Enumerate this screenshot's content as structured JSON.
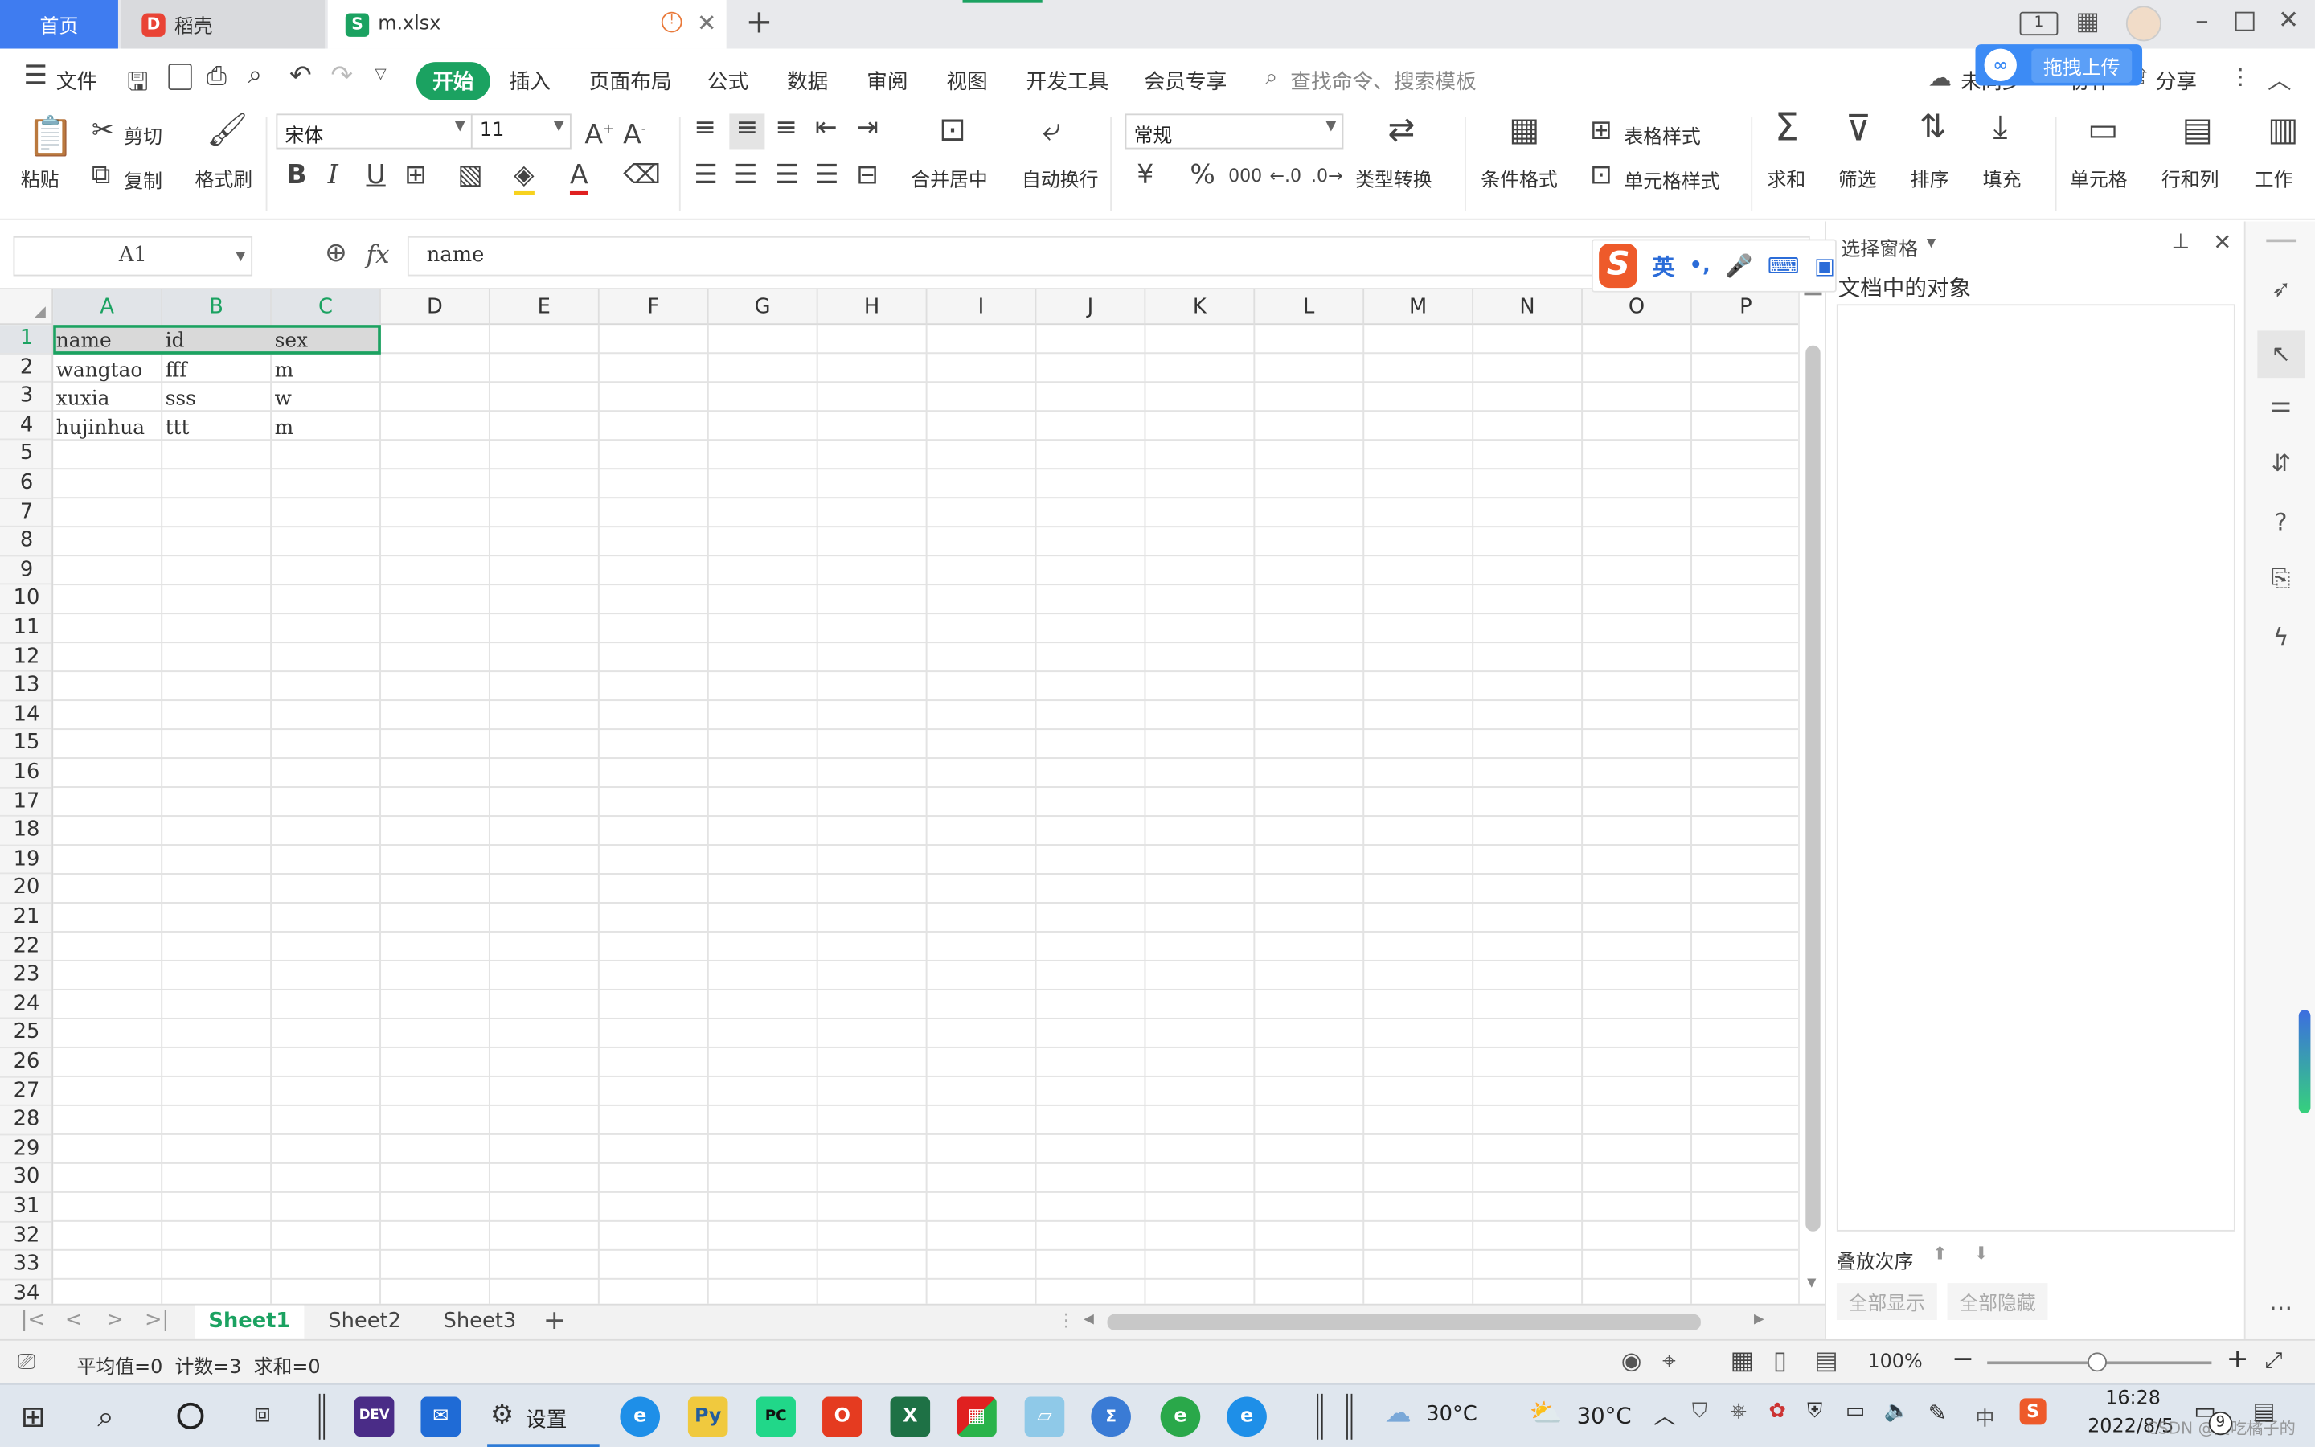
{
  "tabs": {
    "home": "首页",
    "daoke": "稻壳",
    "file": "m.xlsx",
    "new_tab": "+"
  },
  "menu": {
    "file": "文件",
    "items": [
      "开始",
      "插入",
      "页面布局",
      "公式",
      "数据",
      "审阅",
      "视图",
      "开发工具",
      "会员专享"
    ],
    "search_placeholder": "查找命令、搜索模板",
    "sync": "未同步",
    "collab": "协作",
    "share": "分享",
    "upload": "拖拽上传"
  },
  "ribbon": {
    "paste": "粘贴",
    "cut": "剪切",
    "copy": "复制",
    "format_painter": "格式刷",
    "font_name": "宋体",
    "font_size": "11",
    "merge_center": "合并居中",
    "wrap_text": "自动换行",
    "number_format": "常规",
    "currency": "¥",
    "percent": "%",
    "thousands": "000",
    "type_convert": "类型转换",
    "cond_format": "条件格式",
    "table_style": "表格样式",
    "cell_style": "单元格样式",
    "sum": "求和",
    "filter": "筛选",
    "sort": "排序",
    "fill": "填充",
    "cell": "单元格",
    "row_col": "行和列",
    "worksheet": "工作"
  },
  "formula_bar": {
    "name_box": "A1",
    "fx": "fx",
    "content": "name"
  },
  "grid": {
    "columns": [
      "A",
      "B",
      "C",
      "D",
      "E",
      "F",
      "G",
      "H",
      "I",
      "J",
      "K",
      "L",
      "M",
      "N",
      "O",
      "P"
    ],
    "rows": [
      "1",
      "2",
      "3",
      "4",
      "5",
      "6",
      "7",
      "8",
      "9",
      "10",
      "11",
      "12",
      "13",
      "14",
      "15",
      "16",
      "17",
      "18",
      "19",
      "20",
      "21",
      "22",
      "23",
      "24",
      "25",
      "26",
      "27",
      "28",
      "29",
      "30",
      "31",
      "32",
      "33",
      "34"
    ],
    "data": [
      [
        "name",
        "id",
        "sex"
      ],
      [
        "wangtao",
        "fff",
        "m"
      ],
      [
        "xuxia",
        "sss",
        "w"
      ],
      [
        "hujinhua",
        "ttt",
        "m"
      ]
    ]
  },
  "sheets": [
    "Sheet1",
    "Sheet2",
    "Sheet3"
  ],
  "status": {
    "stats": "平均值=0  计数=3  求和=0",
    "zoom": "100%"
  },
  "pane": {
    "title": "选择窗格",
    "heading": "文档中的对象",
    "order_label": "叠放次序",
    "show_all": "全部显示",
    "hide_all": "全部隐藏"
  },
  "ime": {
    "lang": "英"
  },
  "taskbar": {
    "settings": "设置",
    "weather1": "30°C",
    "weather2": "30°C",
    "time": "16:28",
    "date": "2022/8/5",
    "notifications": "9",
    "ime_cn": "中",
    "watermark": "CSDN @爱吃橘子的"
  }
}
